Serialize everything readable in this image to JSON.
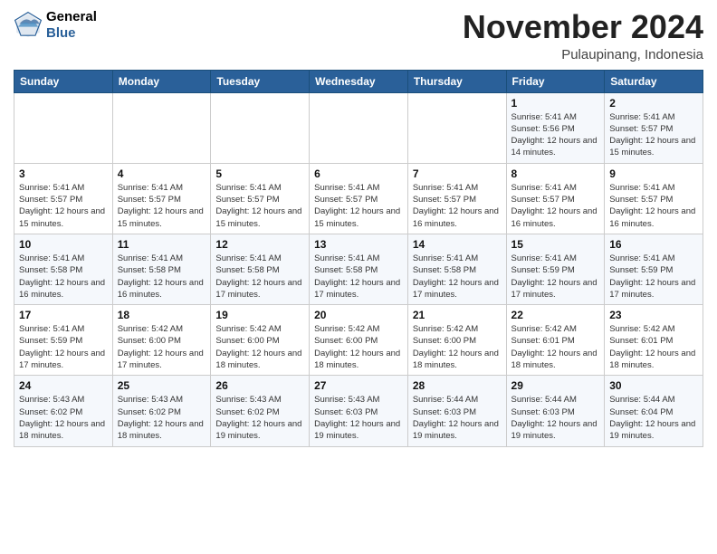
{
  "header": {
    "logo": {
      "line1": "General",
      "line2": "Blue"
    },
    "month": "November 2024",
    "location": "Pulaupinang, Indonesia"
  },
  "weekdays": [
    "Sunday",
    "Monday",
    "Tuesday",
    "Wednesday",
    "Thursday",
    "Friday",
    "Saturday"
  ],
  "weeks": [
    [
      {
        "day": "",
        "info": ""
      },
      {
        "day": "",
        "info": ""
      },
      {
        "day": "",
        "info": ""
      },
      {
        "day": "",
        "info": ""
      },
      {
        "day": "",
        "info": ""
      },
      {
        "day": "1",
        "info": "Sunrise: 5:41 AM\nSunset: 5:56 PM\nDaylight: 12 hours\nand 14 minutes."
      },
      {
        "day": "2",
        "info": "Sunrise: 5:41 AM\nSunset: 5:57 PM\nDaylight: 12 hours\nand 15 minutes."
      }
    ],
    [
      {
        "day": "3",
        "info": "Sunrise: 5:41 AM\nSunset: 5:57 PM\nDaylight: 12 hours\nand 15 minutes."
      },
      {
        "day": "4",
        "info": "Sunrise: 5:41 AM\nSunset: 5:57 PM\nDaylight: 12 hours\nand 15 minutes."
      },
      {
        "day": "5",
        "info": "Sunrise: 5:41 AM\nSunset: 5:57 PM\nDaylight: 12 hours\nand 15 minutes."
      },
      {
        "day": "6",
        "info": "Sunrise: 5:41 AM\nSunset: 5:57 PM\nDaylight: 12 hours\nand 15 minutes."
      },
      {
        "day": "7",
        "info": "Sunrise: 5:41 AM\nSunset: 5:57 PM\nDaylight: 12 hours\nand 16 minutes."
      },
      {
        "day": "8",
        "info": "Sunrise: 5:41 AM\nSunset: 5:57 PM\nDaylight: 12 hours\nand 16 minutes."
      },
      {
        "day": "9",
        "info": "Sunrise: 5:41 AM\nSunset: 5:57 PM\nDaylight: 12 hours\nand 16 minutes."
      }
    ],
    [
      {
        "day": "10",
        "info": "Sunrise: 5:41 AM\nSunset: 5:58 PM\nDaylight: 12 hours\nand 16 minutes."
      },
      {
        "day": "11",
        "info": "Sunrise: 5:41 AM\nSunset: 5:58 PM\nDaylight: 12 hours\nand 16 minutes."
      },
      {
        "day": "12",
        "info": "Sunrise: 5:41 AM\nSunset: 5:58 PM\nDaylight: 12 hours\nand 17 minutes."
      },
      {
        "day": "13",
        "info": "Sunrise: 5:41 AM\nSunset: 5:58 PM\nDaylight: 12 hours\nand 17 minutes."
      },
      {
        "day": "14",
        "info": "Sunrise: 5:41 AM\nSunset: 5:58 PM\nDaylight: 12 hours\nand 17 minutes."
      },
      {
        "day": "15",
        "info": "Sunrise: 5:41 AM\nSunset: 5:59 PM\nDaylight: 12 hours\nand 17 minutes."
      },
      {
        "day": "16",
        "info": "Sunrise: 5:41 AM\nSunset: 5:59 PM\nDaylight: 12 hours\nand 17 minutes."
      }
    ],
    [
      {
        "day": "17",
        "info": "Sunrise: 5:41 AM\nSunset: 5:59 PM\nDaylight: 12 hours\nand 17 minutes."
      },
      {
        "day": "18",
        "info": "Sunrise: 5:42 AM\nSunset: 6:00 PM\nDaylight: 12 hours\nand 17 minutes."
      },
      {
        "day": "19",
        "info": "Sunrise: 5:42 AM\nSunset: 6:00 PM\nDaylight: 12 hours\nand 18 minutes."
      },
      {
        "day": "20",
        "info": "Sunrise: 5:42 AM\nSunset: 6:00 PM\nDaylight: 12 hours\nand 18 minutes."
      },
      {
        "day": "21",
        "info": "Sunrise: 5:42 AM\nSunset: 6:00 PM\nDaylight: 12 hours\nand 18 minutes."
      },
      {
        "day": "22",
        "info": "Sunrise: 5:42 AM\nSunset: 6:01 PM\nDaylight: 12 hours\nand 18 minutes."
      },
      {
        "day": "23",
        "info": "Sunrise: 5:42 AM\nSunset: 6:01 PM\nDaylight: 12 hours\nand 18 minutes."
      }
    ],
    [
      {
        "day": "24",
        "info": "Sunrise: 5:43 AM\nSunset: 6:02 PM\nDaylight: 12 hours\nand 18 minutes."
      },
      {
        "day": "25",
        "info": "Sunrise: 5:43 AM\nSunset: 6:02 PM\nDaylight: 12 hours\nand 18 minutes."
      },
      {
        "day": "26",
        "info": "Sunrise: 5:43 AM\nSunset: 6:02 PM\nDaylight: 12 hours\nand 19 minutes."
      },
      {
        "day": "27",
        "info": "Sunrise: 5:43 AM\nSunset: 6:03 PM\nDaylight: 12 hours\nand 19 minutes."
      },
      {
        "day": "28",
        "info": "Sunrise: 5:44 AM\nSunset: 6:03 PM\nDaylight: 12 hours\nand 19 minutes."
      },
      {
        "day": "29",
        "info": "Sunrise: 5:44 AM\nSunset: 6:03 PM\nDaylight: 12 hours\nand 19 minutes."
      },
      {
        "day": "30",
        "info": "Sunrise: 5:44 AM\nSunset: 6:04 PM\nDaylight: 12 hours\nand 19 minutes."
      }
    ]
  ]
}
